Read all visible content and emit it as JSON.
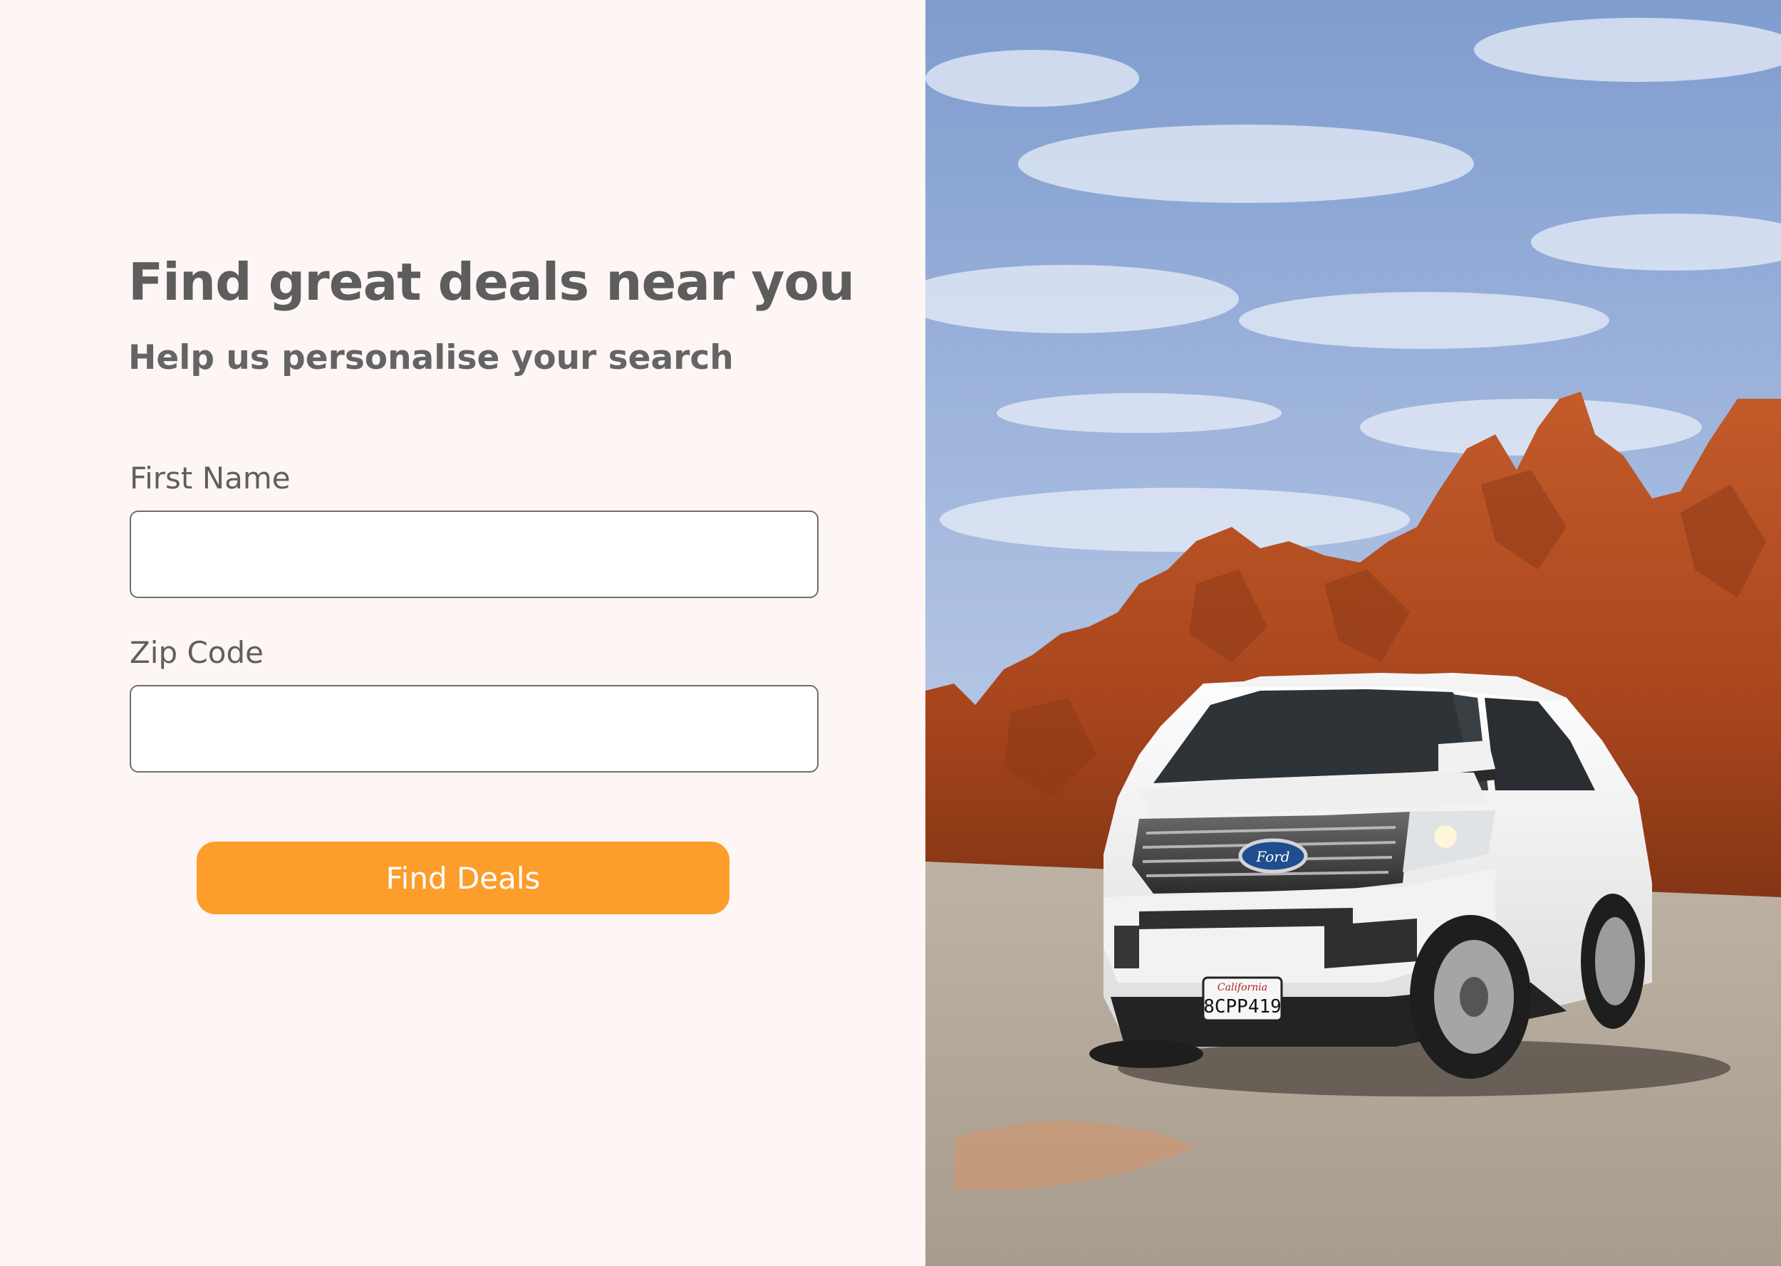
{
  "form": {
    "title": "Find great deals near you",
    "subtitle": "Help us personalise your search",
    "first_name_label": "First Name",
    "first_name_value": "",
    "zip_label": "Zip Code",
    "zip_value": "",
    "submit_label": "Find Deals"
  },
  "photo": {
    "plate_state": "California",
    "plate_number": "8CPP419",
    "badge": "Ford"
  },
  "colors": {
    "background": "#fdf6f4",
    "text": "#5d5d5d",
    "accent": "#fd9d2b",
    "input_border": "#6f6f6f"
  }
}
